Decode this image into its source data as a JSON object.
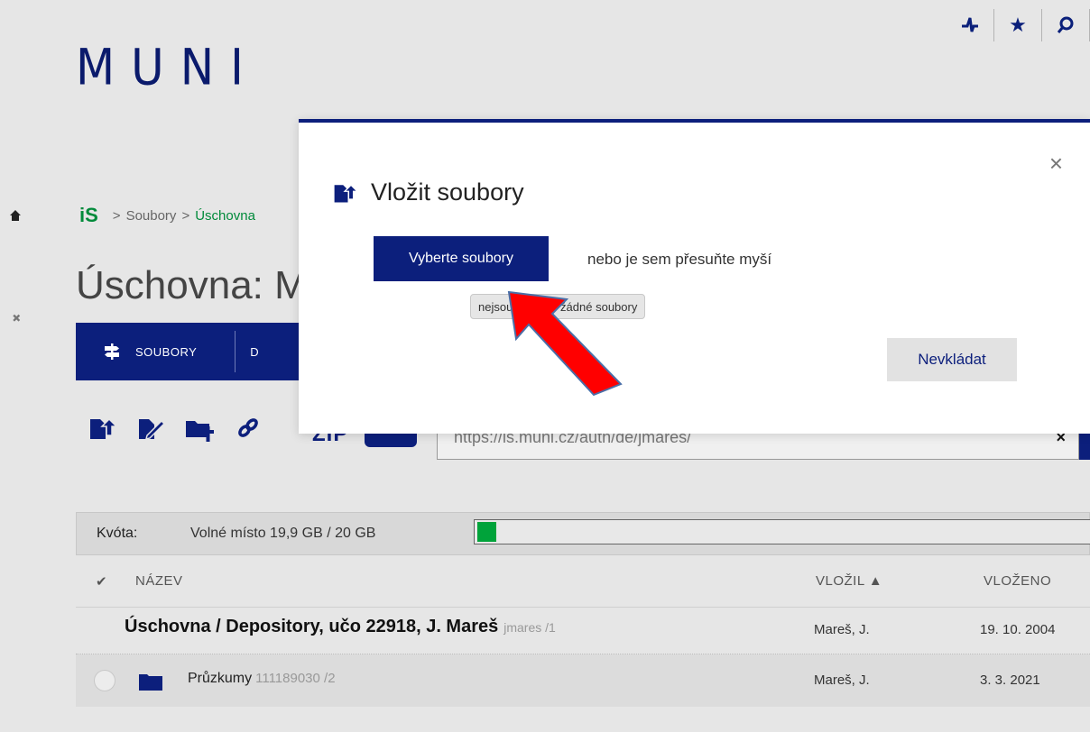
{
  "header": {
    "logo_text": "MUNI",
    "icons": [
      "pulse-icon",
      "star-icon",
      "search-icon"
    ]
  },
  "breadcrumb": {
    "root": "iS",
    "items": [
      "Soubory",
      "Úschovna"
    ]
  },
  "page_title": "Úschovna: M",
  "navbar": {
    "items": [
      {
        "label": "SOUBORY",
        "icon": "signpost-icon"
      },
      {
        "label": "D"
      }
    ]
  },
  "toolbar": {
    "icons": [
      "upload-file-icon",
      "edit-file-icon",
      "add-folder-icon",
      "link-icon"
    ],
    "zip_label": "ZIP",
    "url_value": "https://is.muni.cz/auth/de/jmares/",
    "url_clear": "×"
  },
  "quota": {
    "label": "Kvóta:",
    "value": "Volné místo 19,9 GB / 20 GB",
    "used_fraction": 0.03,
    "fill_color": "#00a33a"
  },
  "table": {
    "headers": {
      "name": "NÁZEV",
      "added_by": "VLOŽIL ▲",
      "added": "VLOŽENO"
    },
    "rows": [
      {
        "name": "Úschovna / Depository, učo 22918, J. Mareš",
        "sub": "jmares /1",
        "added_by": "Mareš, J.",
        "added": "19. 10. 2004"
      },
      {
        "name": "Průzkumy",
        "sub": "111189030 /2",
        "added_by": "Mareš, J.",
        "added": "3. 3. 2021"
      }
    ]
  },
  "modal": {
    "title": "Vložit soubory",
    "close": "×",
    "pick_button": "Vyberte soubory",
    "drag_hint": "nebo je sem přesuňte myší",
    "tooltip": "nejsou vybrány žádné soubory",
    "cancel_button": "Nevkládat"
  },
  "colors": {
    "brand": "#0c1f7c",
    "accent_green": "#008a3a",
    "annotation_arrow": "#ff0000"
  }
}
